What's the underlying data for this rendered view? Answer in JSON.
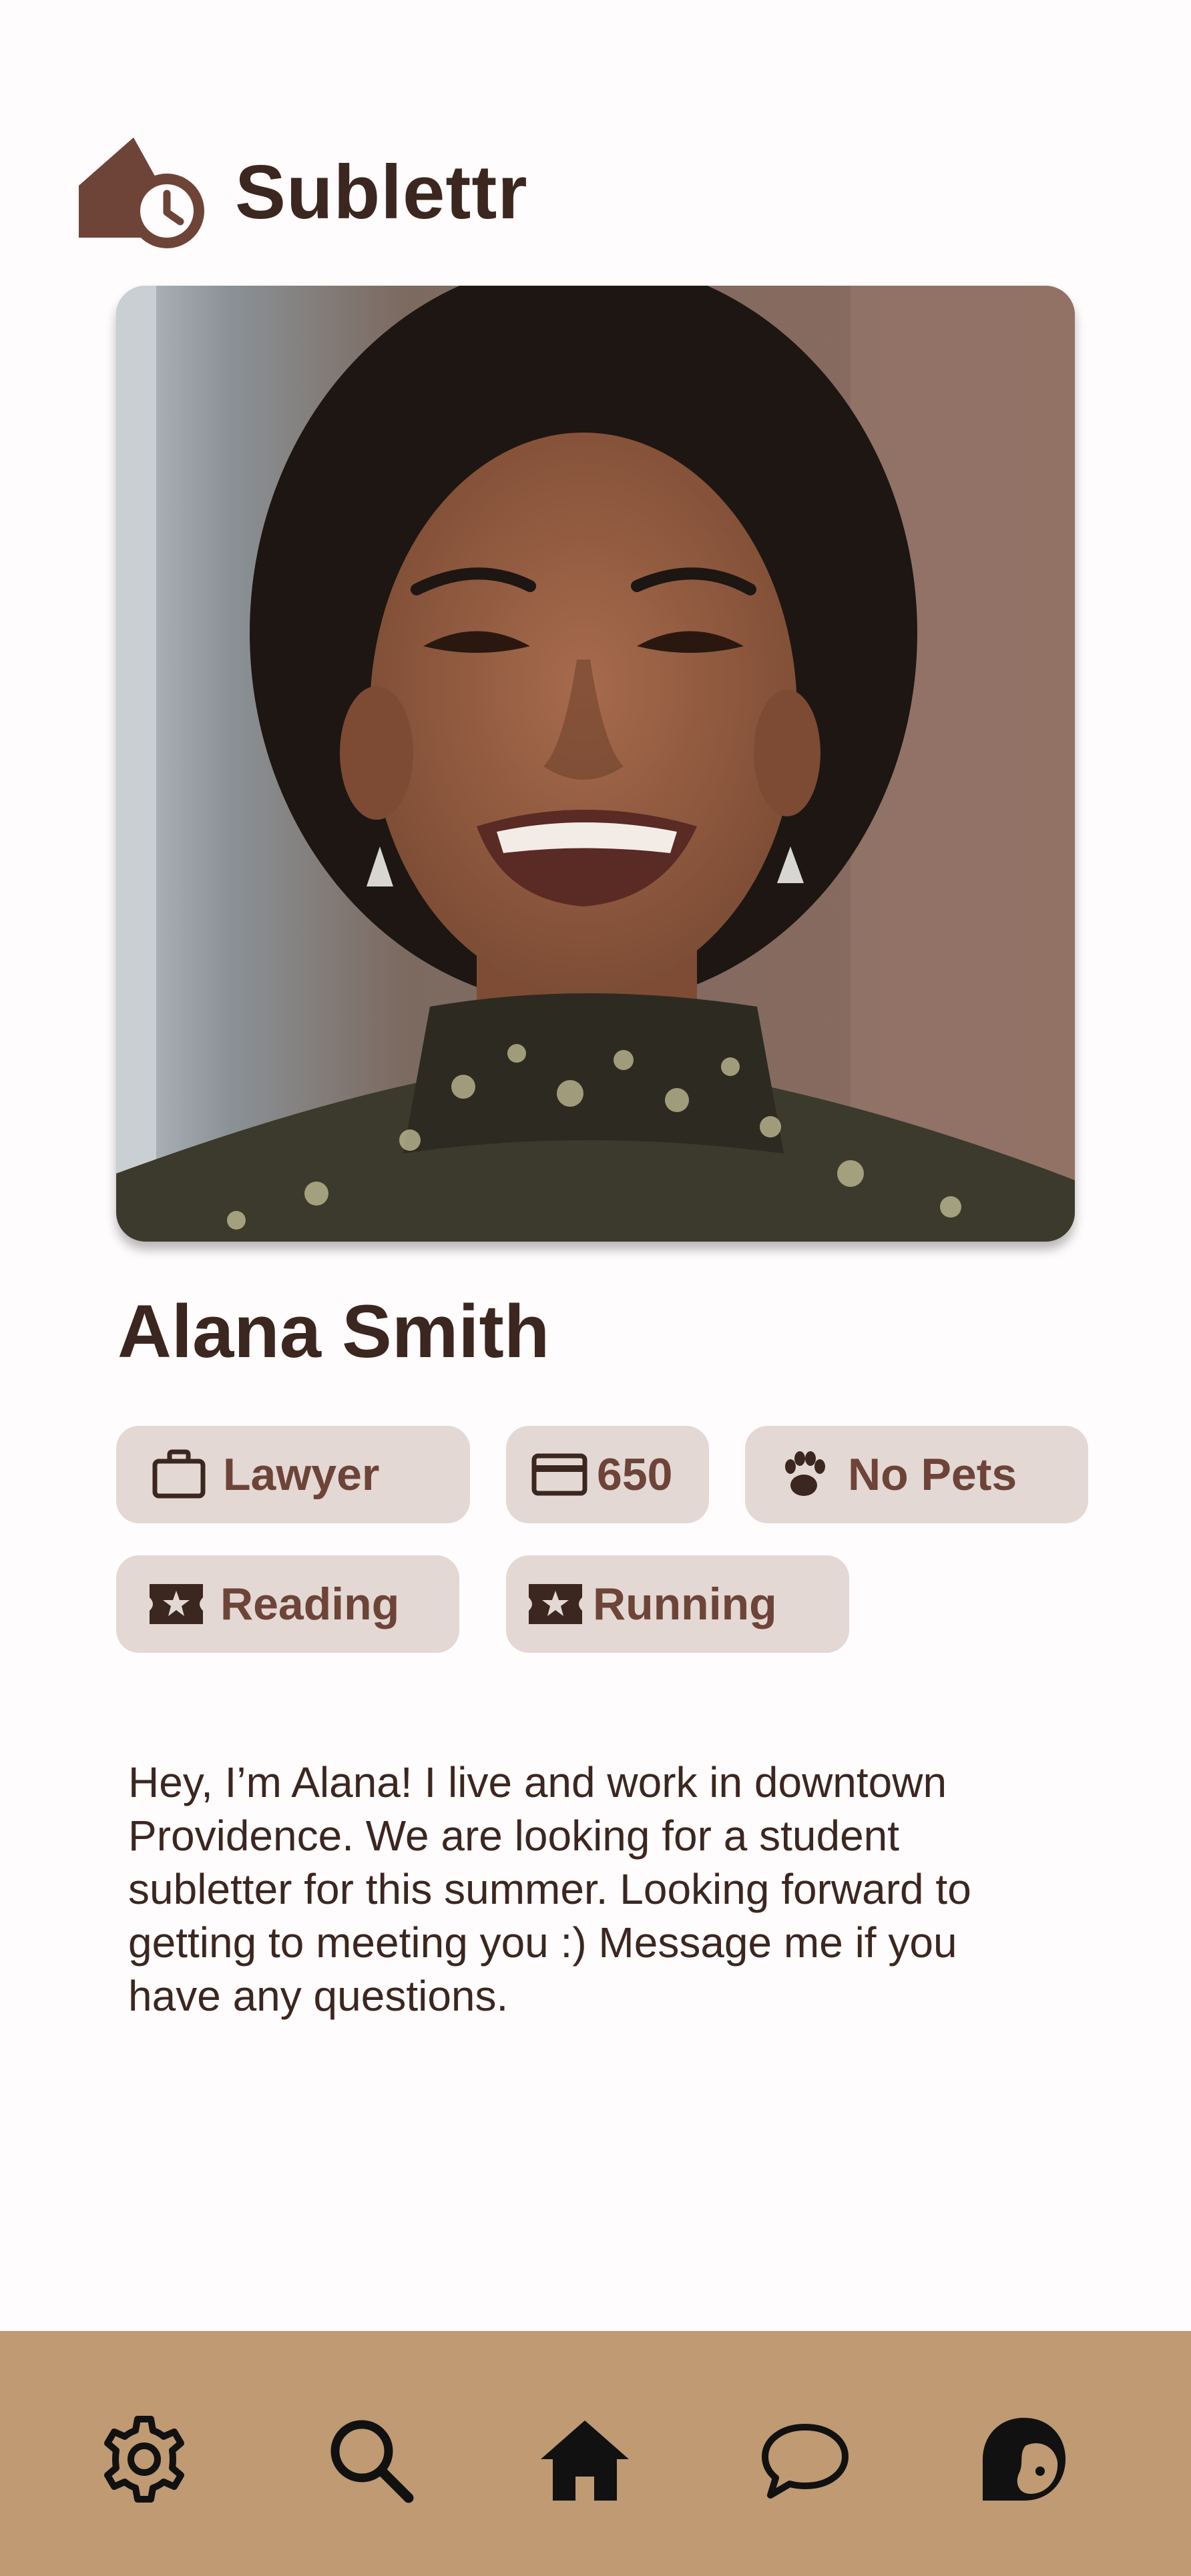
{
  "app": {
    "title": "Sublettr",
    "logo_icon": "house-clock-icon"
  },
  "profile": {
    "photo_icon": "profile-photo",
    "name": "Alana Smith",
    "tags": {
      "occupation": {
        "icon": "briefcase-icon",
        "label": "Lawyer"
      },
      "budget": {
        "icon": "credit-card-icon",
        "label": "650"
      },
      "pets": {
        "icon": "paw-icon",
        "label": "No Pets"
      },
      "hobbies": [
        {
          "icon": "star-ticket-icon",
          "label": "Reading"
        },
        {
          "icon": "star-ticket-icon",
          "label": "Running"
        }
      ]
    },
    "bio": "Hey, I’m Alana! I live and work in downtown Providence. We are looking for a student subletter for this summer. Looking forward to getting to meeting you :) Message me if you have any questions."
  },
  "nav": {
    "items": [
      {
        "icon": "gear-icon"
      },
      {
        "icon": "search-icon"
      },
      {
        "icon": "home-icon"
      },
      {
        "icon": "chat-bubble-icon"
      },
      {
        "icon": "profile-face-icon"
      }
    ]
  },
  "colors": {
    "background": "#fefcfc",
    "text_dark": "#3c2620",
    "brand_brown": "#6e4438",
    "tag_background": "#e3d8d4",
    "nav_background": "#bf9a72"
  }
}
